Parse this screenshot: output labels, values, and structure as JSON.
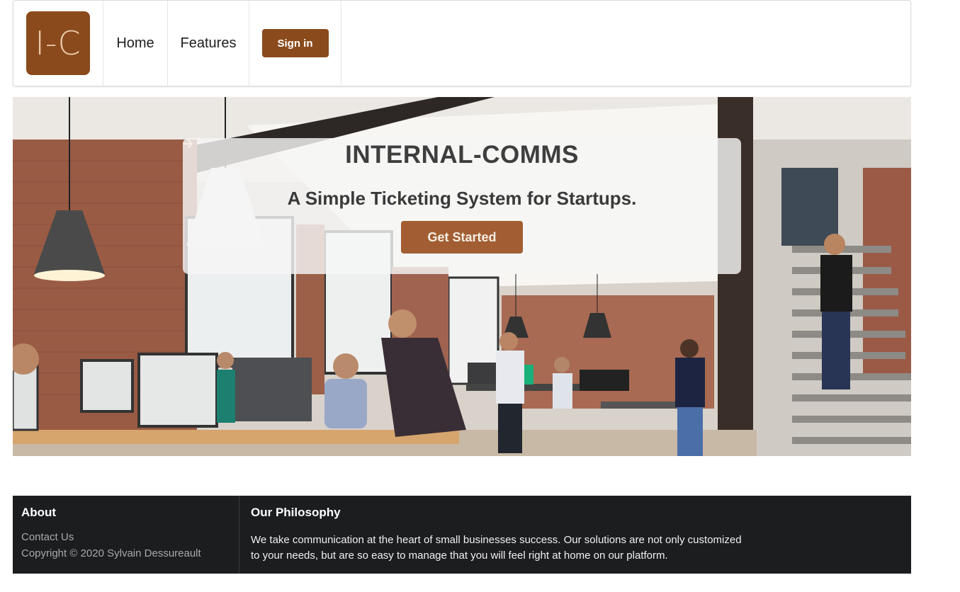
{
  "nav": {
    "logo_text": "I-C",
    "home": "Home",
    "features": "Features",
    "signin": "Sign in"
  },
  "hero": {
    "title": "INTERNAL-COMMS",
    "subtitle": "A Simple Ticketing System for Startups.",
    "cta_label": "Get Started",
    "cta_icon": "arrow-right-icon"
  },
  "footer": {
    "about_heading": "About",
    "contact_link": "Contact Us",
    "copyright": "Copyright © 2020 Sylvain Dessureault",
    "philosophy_heading": "Our Philosophy",
    "philosophy_text": "We take communication at the heart of small businesses success. Our solutions are not only customized to your needs, but are so easy to manage that you will feel right at home on our platform."
  },
  "colors": {
    "brand": "#8a4a1c",
    "cta": "#a25e32",
    "footer_bg": "#1c1d1f"
  }
}
